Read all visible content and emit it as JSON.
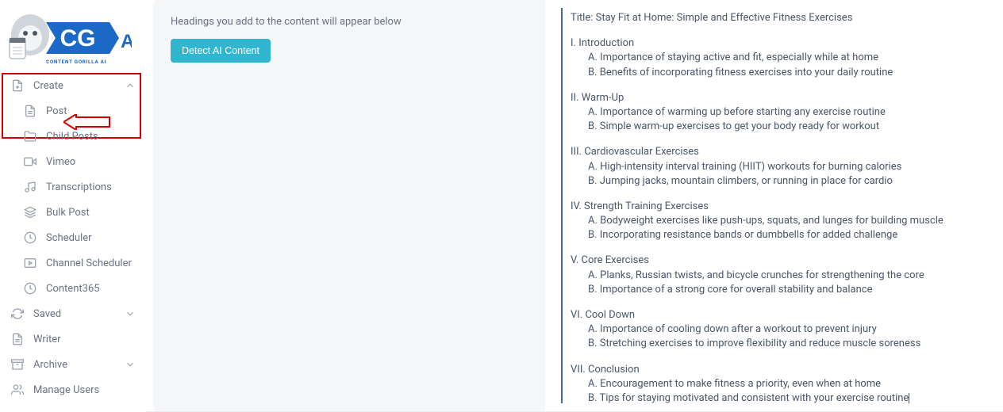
{
  "sidebar": {
    "create_label": "Create",
    "items": [
      {
        "label": "Post"
      },
      {
        "label": "Child Posts"
      },
      {
        "label": "Vimeo"
      },
      {
        "label": "Transcriptions"
      },
      {
        "label": "Bulk Post"
      },
      {
        "label": "Scheduler"
      },
      {
        "label": "Channel Scheduler"
      },
      {
        "label": "Content365"
      }
    ],
    "saved_label": "Saved",
    "writer_label": "Writer",
    "archive_label": "Archive",
    "manage_users_label": "Manage Users"
  },
  "main": {
    "headings_hint": "Headings you add to the content will appear below",
    "detect_button": "Detect AI Content"
  },
  "outline": {
    "title": "Title: Stay Fit at Home: Simple and Effective Fitness Exercises",
    "sections": [
      {
        "heading": "I. Introduction",
        "points": [
          "A. Importance of staying active and fit, especially while at home",
          "B. Benefits of incorporating fitness exercises into your daily routine"
        ]
      },
      {
        "heading": "II. Warm-Up",
        "points": [
          "A. Importance of warming up before starting any exercise routine",
          "B. Simple warm-up exercises to get your body ready for workout"
        ]
      },
      {
        "heading": "III. Cardiovascular Exercises",
        "points": [
          "A. High-intensity interval training (HIIT) workouts for burning calories",
          "B. Jumping jacks, mountain climbers, or running in place for cardio"
        ]
      },
      {
        "heading": "IV. Strength Training Exercises",
        "points": [
          "A. Bodyweight exercises like push-ups, squats, and lunges for building muscle",
          "B. Incorporating resistance bands or dumbbells for added challenge"
        ]
      },
      {
        "heading": "V. Core Exercises",
        "points": [
          "A. Planks, Russian twists, and bicycle crunches for strengthening the core",
          "B. Importance of a strong core for overall stability and balance"
        ]
      },
      {
        "heading": "VI. Cool Down",
        "points": [
          "A. Importance of cooling down after a workout to prevent injury",
          "B. Stretching exercises to improve flexibility and reduce muscle soreness"
        ]
      },
      {
        "heading": "VII. Conclusion",
        "points": [
          "A. Encouragement to make fitness a priority, even when at home",
          "B. Tips for staying motivated and consistent with your exercise routine"
        ]
      }
    ]
  }
}
